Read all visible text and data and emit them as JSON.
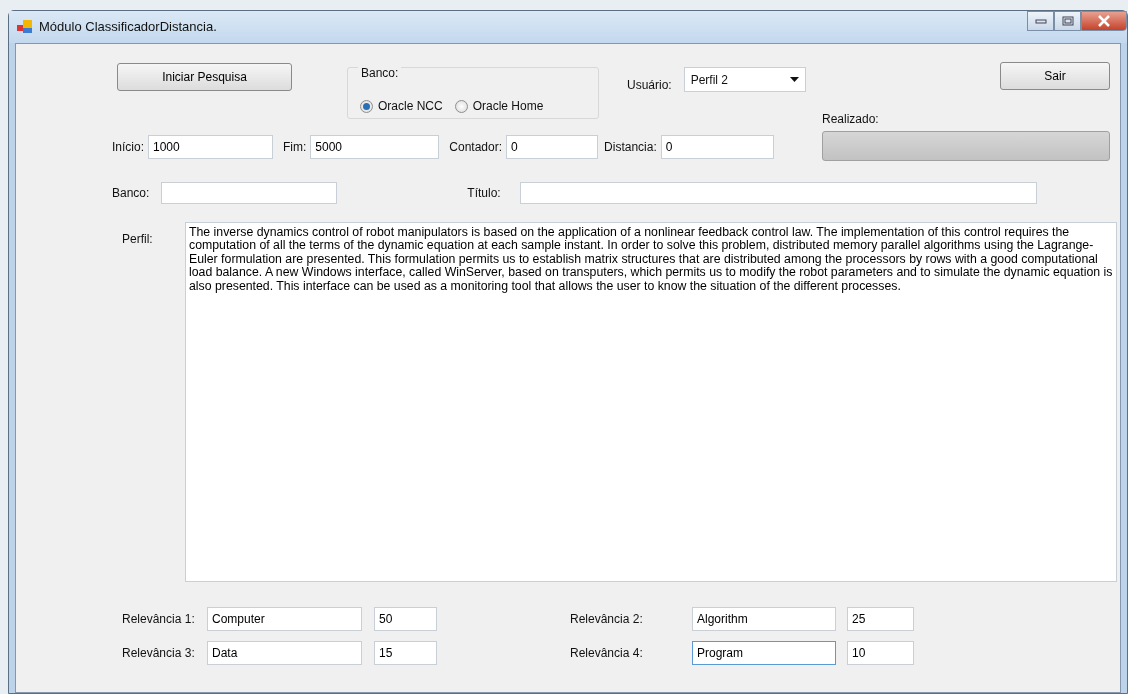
{
  "window": {
    "title": "Módulo ClassificadorDistancia."
  },
  "search_button": {
    "label": "Iniciar Pesquisa"
  },
  "banco_group": {
    "legend": "Banco:",
    "options": [
      {
        "label": "Oracle NCC",
        "selected": true
      },
      {
        "label": "Oracle Home",
        "selected": false
      }
    ]
  },
  "usuario": {
    "label": "Usuário:",
    "value": "Perfil 2"
  },
  "exit_button": {
    "label": "Sair"
  },
  "progress": {
    "label": "Realizado:",
    "level": 0
  },
  "range_fields": [
    {
      "label": "Início:",
      "value": "1000"
    },
    {
      "label": "Fim:",
      "value": "5000"
    },
    {
      "label": "Contador:",
      "value": "0"
    },
    {
      "label": "Distancia:",
      "value": "0"
    }
  ],
  "banco_field": {
    "label": "Banco:"
  },
  "titulo_field": {
    "label": "Título:"
  },
  "perfil": {
    "label": "Perfil:",
    "value": "The inverse dynamics control of robot manipulators is based on the application of a nonlinear feedback control law. The implementation of this control requires the computation of all the terms of the dynamic equation at each sample instant. In order to solve this problem, distributed memory parallel algorithms using the Lagrange-Euler formulation are presented. This formulation permits us to establish matrix structures that are distributed among the processors by rows with a good computational load balance. A new Windows interface, called WinServer, based on transputers, which permits us to modify the robot parameters and to simulate the dynamic equation is also presented. This interface can be used as a monitoring tool that allows the user to know the situation of the different processes."
  },
  "relevance": [
    {
      "label": "Relevância 1:",
      "term": "Computer",
      "weight": "50",
      "focused": false
    },
    {
      "label": "Relevância 2:",
      "term": "Algorithm",
      "weight": "25",
      "focused": false
    },
    {
      "label": "Relevância 3:",
      "term": "Data",
      "weight": "15",
      "focused": false
    },
    {
      "label": "Relevância 4:",
      "term": "Program",
      "weight": "10",
      "focused": true
    }
  ]
}
